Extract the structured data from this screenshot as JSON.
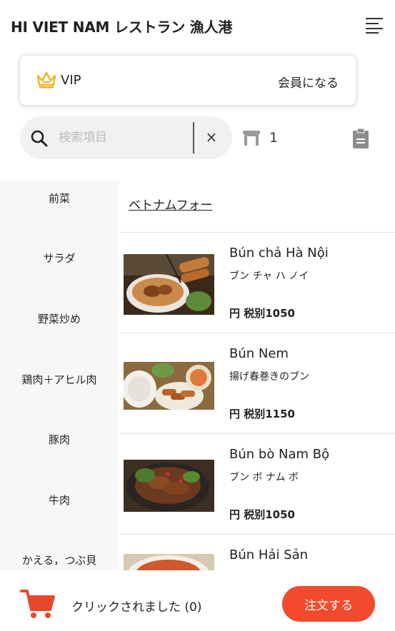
{
  "header": {
    "title": "HI VIET NAM レストラン 漁人港",
    "menu_icon": "menu-icon"
  },
  "vip": {
    "label": "VIP",
    "join_label": "会員になる",
    "crown_color": "#f0b323"
  },
  "search": {
    "placeholder": "検索項目",
    "value": "",
    "clear_label": "×"
  },
  "table": {
    "number": "1"
  },
  "sidebar": {
    "categories": [
      {
        "label": "前菜"
      },
      {
        "label": "サラダ"
      },
      {
        "label": "野菜炒め"
      },
      {
        "label": "鶏肉＋アヒル肉"
      },
      {
        "label": "豚肉"
      },
      {
        "label": "牛肉"
      },
      {
        "label": "かえる，つぶ貝"
      }
    ]
  },
  "menu": {
    "section_title": "ベトナムフォー",
    "items": [
      {
        "name": "Bún chả Hà Nội",
        "sub": "ブン チャ ハ ノイ",
        "price": "円 税别1050"
      },
      {
        "name": "Bún Nem",
        "sub": "揚げ春巻きのブン",
        "price": "円 税别1150"
      },
      {
        "name": "Bún bò Nam Bộ",
        "sub": "ブン ボ ナム ボ",
        "price": "円 税别1050"
      },
      {
        "name": "Bún Hải Sản",
        "sub": "",
        "price": ""
      }
    ]
  },
  "footer": {
    "clicked_label": "クリックされました (0)",
    "order_label": "注文する",
    "accent": "#f24a2c"
  }
}
